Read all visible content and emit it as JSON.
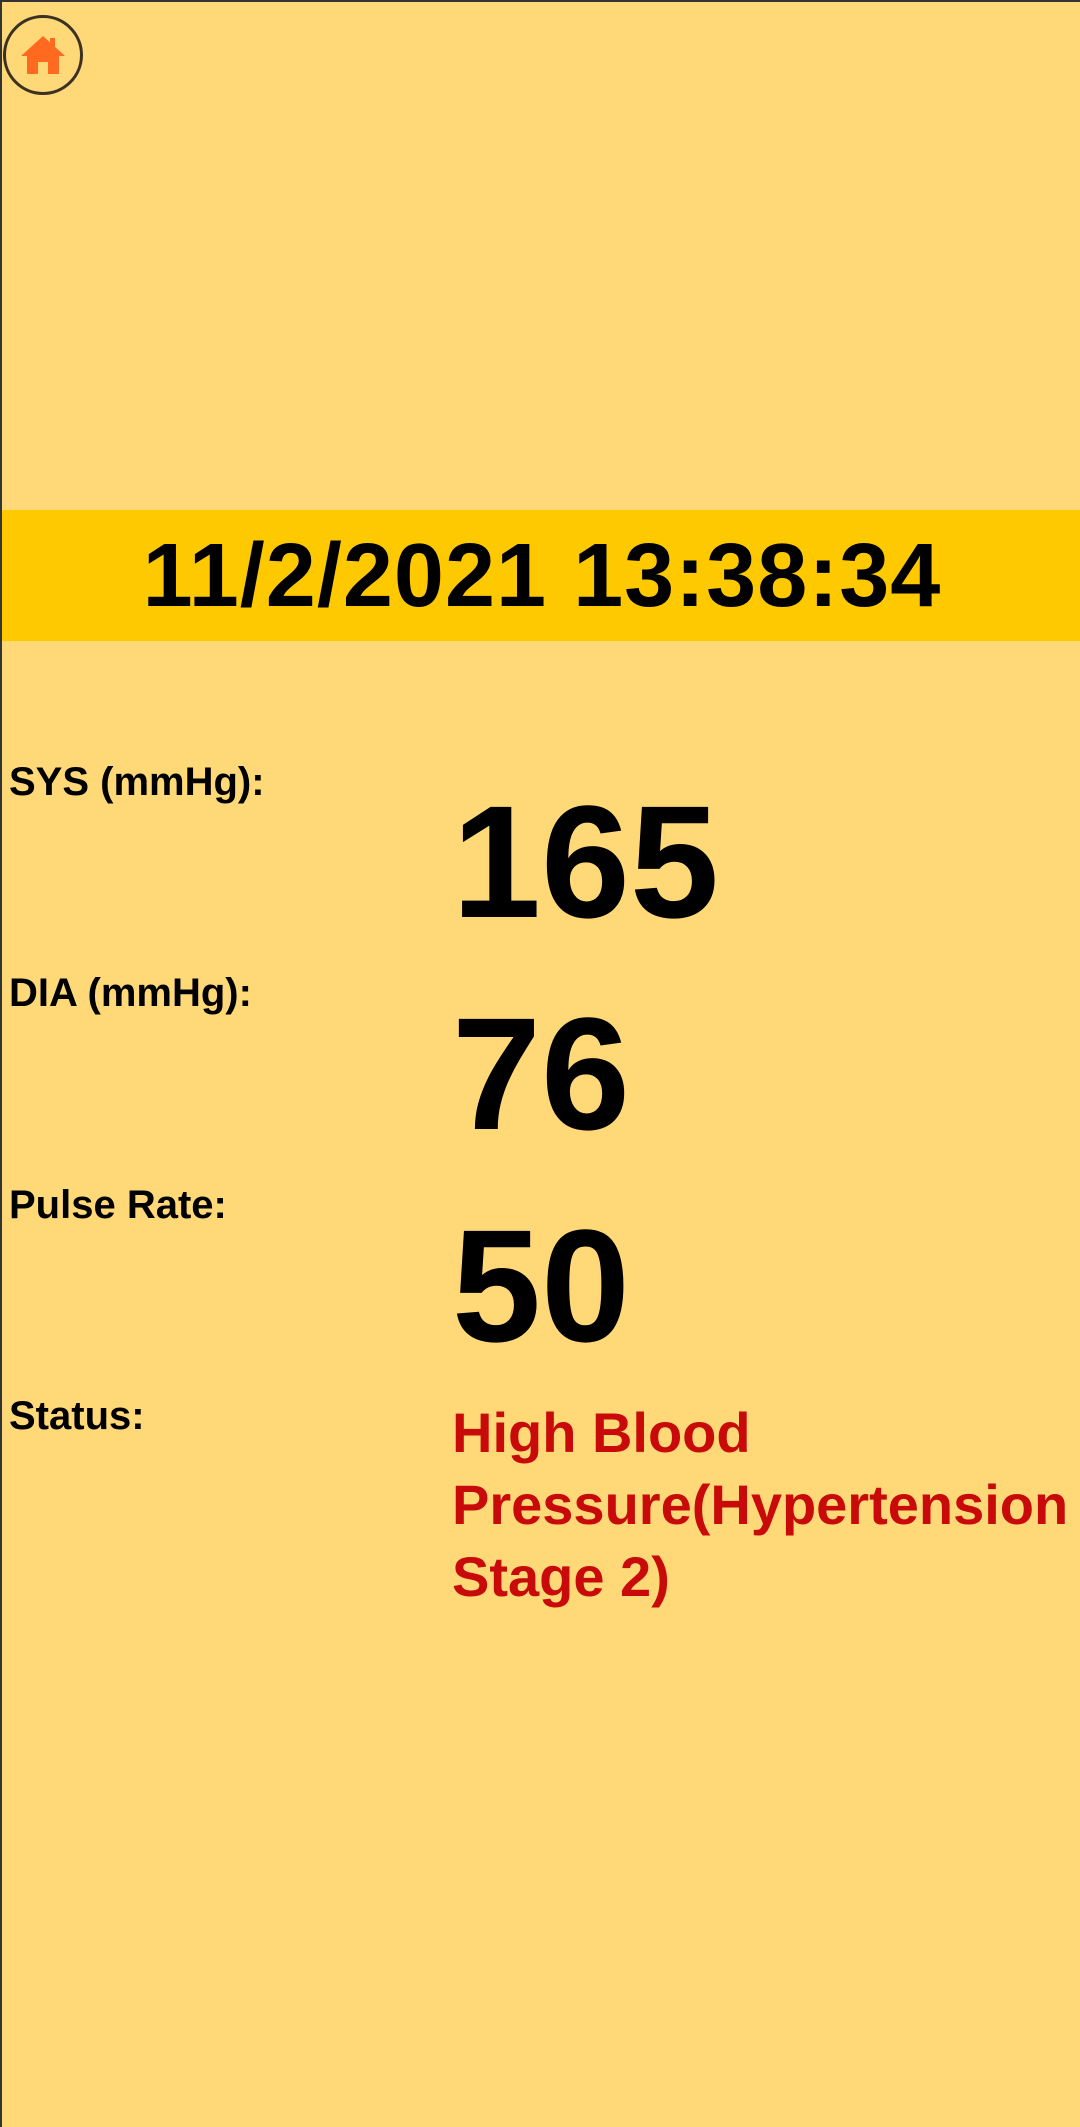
{
  "home_button": {
    "icon": "home-icon",
    "icon_color": "#FF6A20"
  },
  "reading": {
    "datetime": "11/2/2021 13:38:34",
    "sys_label": "SYS (mmHg):",
    "sys_value": "165",
    "dia_label": "DIA (mmHg):",
    "dia_value": "76",
    "pulse_label": "Pulse Rate:",
    "pulse_value": "50",
    "status_label": "Status:",
    "status_value": "High Blood\nPressure(Hypertension\nStage 2)"
  },
  "colors": {
    "background": "#FFD877",
    "date_band": "#FFC900",
    "status_text": "#C80A0A"
  }
}
